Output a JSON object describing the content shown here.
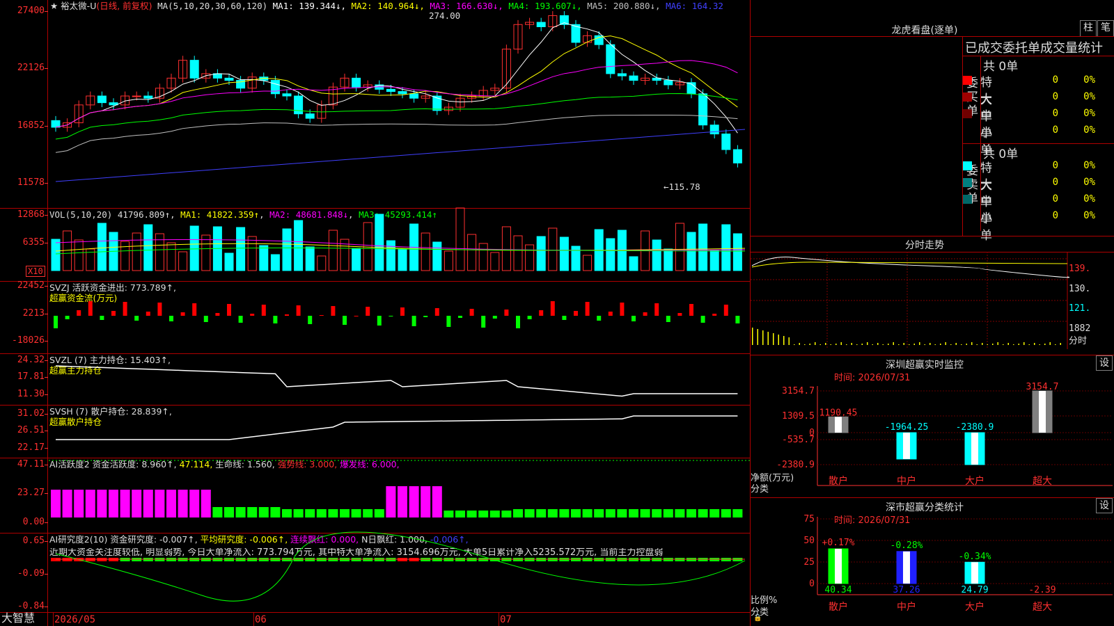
{
  "main": {
    "stock": "★ 裕太微-U",
    "mode": "(日线, 前复权)",
    "ma_params": "MA(5,10,20,30,60,120)",
    "ma": [
      {
        "label": "MA1:",
        "value": "139.344↓",
        "color": "#ffffff"
      },
      {
        "label": "MA2:",
        "value": "140.964↓",
        "color": "#ffff00"
      },
      {
        "label": "MA3:",
        "value": "166.630↓",
        "color": "#ff00ff"
      },
      {
        "label": "MA4:",
        "value": "193.607↓",
        "color": "#00ff00"
      },
      {
        "label": "MA5:",
        "value": "200.880↓",
        "color": "#c0c0c0"
      },
      {
        "label": "MA6:",
        "value": "164.32",
        "color": "#4040ff"
      }
    ],
    "ticks": [
      "27400",
      "22126",
      "16852",
      "11578"
    ],
    "high_label": "274.00",
    "low_label": "←115.78"
  },
  "vol": {
    "params": "VOL(5,10,20)",
    "value": "41796.809↑",
    "ma1": "MA1: 41822.359↑",
    "ma2": "MA2: 48681.848↓",
    "ma3": "MA3: 45293.414↑",
    "ticks": [
      "12868",
      "6355"
    ],
    "unit": "X10"
  },
  "svzj": {
    "title": "SVZJ  活跃资金进出: 773.789↑,",
    "sub": "超赢资金流(万元)",
    "ticks": [
      "22452",
      "2213",
      "-18026"
    ]
  },
  "svzl": {
    "title": "SVZL (7) 主力持仓: 15.403↑,",
    "sub": "超赢主力持仓",
    "ticks": [
      "24.32",
      "17.81",
      "11.30"
    ]
  },
  "svsh": {
    "title": "SVSH (7) 散户持仓: 28.839↑,",
    "sub": "超赢散户持仓",
    "ticks": [
      "31.02",
      "26.51",
      "22.17"
    ]
  },
  "ai1": {
    "title": "AI活跃度2 资金活跃度: 8.960↑,",
    "v2": "47.114,",
    "v3": "生命线: 1.560,",
    "v4": "强势线: 3.000,",
    "v5": "爆发线: 6.000,",
    "ticks": [
      "47.11",
      "23.27",
      "0.00"
    ]
  },
  "ai2": {
    "title": "AI研究度2(10) 资金研究度: -0.007↑,",
    "v2": "平均研究度: -0.006↑,",
    "v3": "连续飘红: 0.000,",
    "v4": "N日飘红: 1.000,",
    "v5": "-0.006↑,",
    "desc": "近期大资金关注度较低, 明显弱势, 今日大单净流入: 773.794万元, 其中特大单净流入: 3154.696万元, 大单5日累计净入5235.572万元, 当前主力控盘弱",
    "ticks": [
      "0.65",
      "-0.09",
      "-0.84"
    ]
  },
  "xaxis": {
    "brand": "大智慧",
    "labels": [
      "2026/05",
      "06",
      "07"
    ]
  },
  "right": {
    "lhb_title": "龙虎看盘(逐单)",
    "btn_bar": "柱",
    "btn_pen": "笔",
    "tabs_header": "已成交委托单成交量统计",
    "buy_group": {
      "side": "委买单",
      "total": "共 0单",
      "rows": [
        {
          "name": "特大",
          "count": "0",
          "pct": "0%",
          "color": "#ff0000"
        },
        {
          "name": "大单",
          "count": "0",
          "pct": "0%",
          "color": "#a00000"
        },
        {
          "name": "中单",
          "count": "0",
          "pct": "0%",
          "color": "#700000"
        },
        {
          "name": "小单",
          "count": "0",
          "pct": "0%",
          "color": ""
        }
      ]
    },
    "sell_group": {
      "side": "委卖单",
      "total": "共 0单",
      "rows": [
        {
          "name": "特大",
          "count": "0",
          "pct": "0%",
          "color": "#00ffff"
        },
        {
          "name": "大单",
          "count": "0",
          "pct": "0%",
          "color": "#008080"
        },
        {
          "name": "中单",
          "count": "0",
          "pct": "0%",
          "color": "#006868"
        },
        {
          "name": "小单",
          "count": "0",
          "pct": "0%",
          "color": ""
        }
      ]
    },
    "intraday_title": "分时走势",
    "intraday_ticks": [
      "139.",
      "130.",
      "121.",
      "1882",
      "分时"
    ],
    "sz_monitor": {
      "title": "深圳超赢实时监控",
      "set": "设",
      "time": "时间: 2026/07/31",
      "ticks": [
        "3154.7",
        "1309.5",
        "0",
        "-535.7",
        "-2380.9"
      ],
      "left1": "净额(万元)",
      "left2": "分类",
      "categories": [
        "散户",
        "中户",
        "大户",
        "超大"
      ],
      "values": [
        1190.45,
        -1964.25,
        -2380.9,
        3154.7
      ],
      "labels": [
        "1190.45",
        "-1964.25",
        "-2380.9",
        "3154.7"
      ]
    },
    "sz_class": {
      "title": "深市超赢分类统计",
      "set": "设",
      "time": "时间: 2026/07/31",
      "ticks": [
        "75",
        "50",
        "25",
        "0"
      ],
      "left1": "比例%",
      "left2": "分类",
      "categories": [
        "散户",
        "中户",
        "大户",
        "超大"
      ],
      "values": [
        40.34,
        37.26,
        24.79,
        -2.39
      ],
      "changes": [
        "+0.17%",
        "-0.28%",
        "-0.34%",
        ""
      ],
      "labels": [
        "40.34",
        "37.26",
        "24.79",
        "-2.39"
      ]
    }
  }
}
